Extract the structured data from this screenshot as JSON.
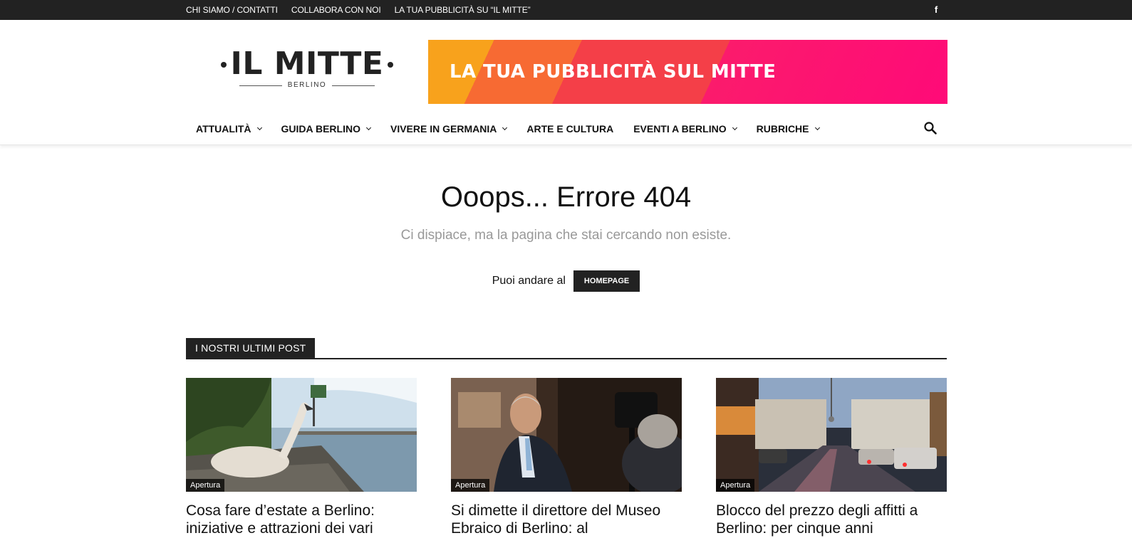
{
  "topbar": {
    "links": [
      "CHI SIAMO / CONTATTI",
      "COLLABORA CON NOI",
      "LA TUA PUBBLICITÀ SU “IL MITTE”"
    ],
    "social_icon": "facebook-icon",
    "social_glyph": "f"
  },
  "logo": {
    "name": "IL MITTE",
    "city": "BERLINO"
  },
  "banner": {
    "text": "LA TUA PUBBLICITÀ SUL MITTE"
  },
  "nav": {
    "items": [
      {
        "label": "ATTUALITÀ",
        "has_dropdown": true
      },
      {
        "label": "GUIDA BERLINO",
        "has_dropdown": true
      },
      {
        "label": "VIVERE IN GERMANIA",
        "has_dropdown": true
      },
      {
        "label": "ARTE E CULTURA",
        "has_dropdown": false
      },
      {
        "label": "EVENTI A BERLINO",
        "has_dropdown": true
      },
      {
        "label": "RUBRICHE",
        "has_dropdown": true
      }
    ],
    "search_icon": "search-icon"
  },
  "error": {
    "title": "Ooops... Errore 404",
    "subtitle": "Ci dispiace, ma la pagina che stai cercando non esiste.",
    "goto_label": "Puoi andare al",
    "button_label": "HOMEPAGE"
  },
  "latest": {
    "heading": "I NOSTRI ULTIMI POST",
    "posts": [
      {
        "category": "Apertura",
        "title": "Cosa fare d’estate a Berlino: iniziative e attrazioni dei vari"
      },
      {
        "category": "Apertura",
        "title": "Si dimette il direttore del Museo Ebraico di Berlino: al"
      },
      {
        "category": "Apertura",
        "title": "Blocco del prezzo degli affitti a Berlino: per cinque anni"
      }
    ]
  },
  "colors": {
    "topbar_bg": "#222222",
    "banner_gradient": [
      "#f8a21c",
      "#f76a33",
      "#f43f48",
      "#ff0a78"
    ],
    "button_bg": "#222222",
    "subtitle": "#999999"
  }
}
